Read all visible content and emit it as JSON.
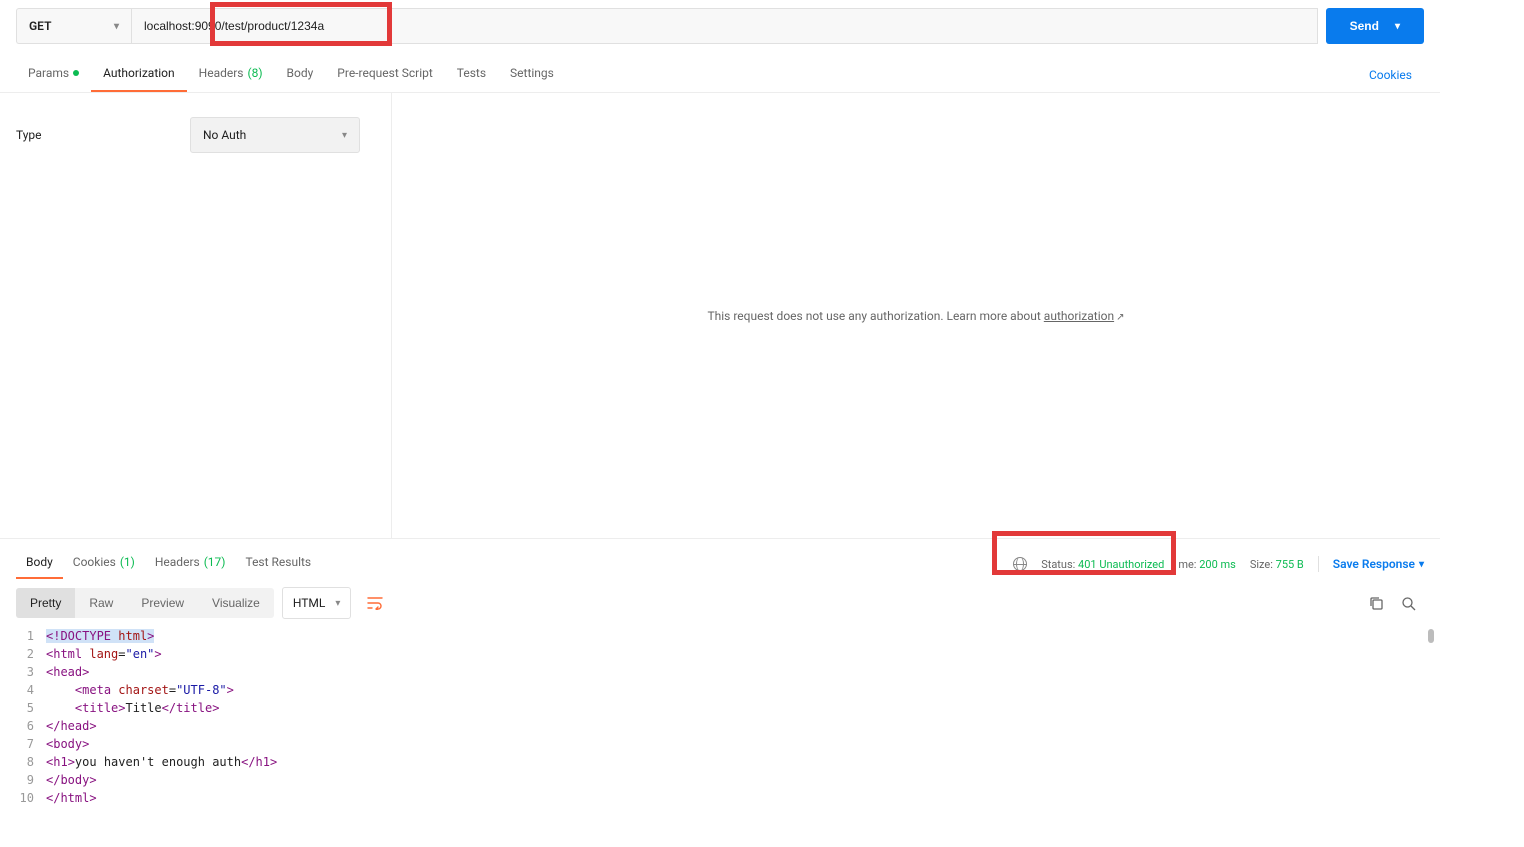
{
  "request": {
    "method": "GET",
    "url": "localhost:9090/test/product/1234a",
    "send_label": "Send"
  },
  "tabs": {
    "params": "Params",
    "authorization": "Authorization",
    "headers": "Headers",
    "headers_count": "(8)",
    "body": "Body",
    "prerequest": "Pre-request Script",
    "tests": "Tests",
    "settings": "Settings",
    "cookies": "Cookies"
  },
  "auth": {
    "type_label": "Type",
    "selected": "No Auth",
    "empty_text": "This request does not use any authorization. ",
    "learn_more": "Learn more about ",
    "link": "authorization"
  },
  "response": {
    "tabs": {
      "body": "Body",
      "cookies": "Cookies",
      "cookies_count": "(1)",
      "headers": "Headers",
      "headers_count": "(17)",
      "test_results": "Test Results"
    },
    "status_label": "Status:",
    "status_value": "401 Unauthorized",
    "time_label": "me:",
    "time_value": "200 ms",
    "size_label": "Size:",
    "size_value": "755 B",
    "save": "Save Response"
  },
  "view": {
    "pretty": "Pretty",
    "raw": "Raw",
    "preview": "Preview",
    "visualize": "Visualize",
    "format": "HTML"
  },
  "code_lines": [
    {
      "n": "1",
      "html": "<span class='sel-bg'><span class='t-ang'>&lt;</span><span class='t-tag'>!DOCTYPE </span><span class='t-attr'>html</span><span class='t-ang'>&gt;</span></span>"
    },
    {
      "n": "2",
      "html": "<span class='t-ang'>&lt;</span><span class='t-tag'>html </span><span class='t-attr'>lang</span><span class='t-txt'>=</span><span class='t-val'>\"en\"</span><span class='t-ang'>&gt;</span>"
    },
    {
      "n": "3",
      "html": "<span class='t-ang'>&lt;</span><span class='t-tag'>head</span><span class='t-ang'>&gt;</span>"
    },
    {
      "n": "4",
      "html": "    <span class='t-ang'>&lt;</span><span class='t-tag'>meta </span><span class='t-attr'>charset</span><span class='t-txt'>=</span><span class='t-val'>\"UTF-8\"</span><span class='t-ang'>&gt;</span>"
    },
    {
      "n": "5",
      "html": "    <span class='t-ang'>&lt;</span><span class='t-tag'>title</span><span class='t-ang'>&gt;</span><span class='t-txt'>Title</span><span class='t-ang'>&lt;/</span><span class='t-tag'>title</span><span class='t-ang'>&gt;</span>"
    },
    {
      "n": "6",
      "html": "<span class='t-ang'>&lt;/</span><span class='t-tag'>head</span><span class='t-ang'>&gt;</span>"
    },
    {
      "n": "7",
      "html": "<span class='t-ang'>&lt;</span><span class='t-tag'>body</span><span class='t-ang'>&gt;</span>"
    },
    {
      "n": "8",
      "html": "<span class='t-ang'>&lt;</span><span class='t-tag'>h1</span><span class='t-ang'>&gt;</span><span class='t-txt'>you haven't enough auth</span><span class='t-ang'>&lt;/</span><span class='t-tag'>h1</span><span class='t-ang'>&gt;</span>"
    },
    {
      "n": "9",
      "html": "<span class='t-ang'>&lt;/</span><span class='t-tag'>body</span><span class='t-ang'>&gt;</span>"
    },
    {
      "n": "10",
      "html": "<span class='t-ang'>&lt;/</span><span class='t-tag'>html</span><span class='t-ang'>&gt;</span>"
    }
  ]
}
